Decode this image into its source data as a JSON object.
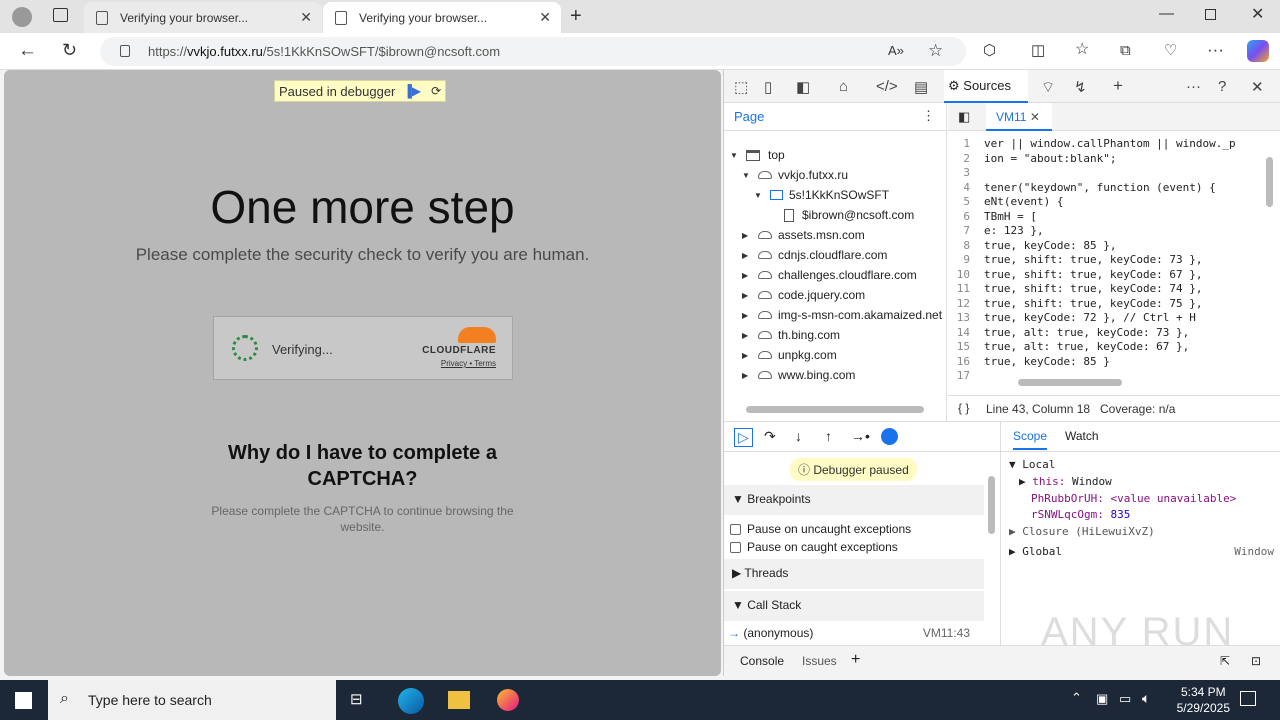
{
  "browser": {
    "tabs": [
      {
        "title": "Verifying your browser..."
      },
      {
        "title": "Verifying your browser..."
      }
    ],
    "url_prefix": "https://",
    "url_domain": "vvkjo.futxx.ru",
    "url_path": "/5s!1KkKnSOwSFT/$ibrown@ncsoft.com"
  },
  "page": {
    "paused_label": "Paused in debugger",
    "headline": "One more step",
    "subline": "Please complete the security check to verify you are human.",
    "widget_status": "Verifying...",
    "cf_brand": "CLOUDFLARE",
    "cf_links": "Privacy • Terms",
    "why_line1": "Why do I have to complete a",
    "why_line2": "CAPTCHA?",
    "why_text": "Please complete the CAPTCHA to continue browsing the website."
  },
  "devtools": {
    "active_tab": "Sources",
    "navigator_tab": "Page",
    "tree": [
      {
        "label": "top"
      },
      {
        "label": "vvkjo.futxx.ru"
      },
      {
        "label": "5s!1KkKnSOwSFT"
      },
      {
        "label": "$ibrown@ncsoft.com"
      },
      {
        "label": "assets.msn.com"
      },
      {
        "label": "cdnjs.cloudflare.com"
      },
      {
        "label": "challenges.cloudflare.com"
      },
      {
        "label": "code.jquery.com"
      },
      {
        "label": "img-s-msn-com.akamaized.net"
      },
      {
        "label": "th.bing.com"
      },
      {
        "label": "unpkg.com"
      },
      {
        "label": "www.bing.com"
      }
    ],
    "file_tab": "VM11",
    "code_lines": [
      {
        "n": "1",
        "t": "ver || window.callPhantom || window._p"
      },
      {
        "n": "2",
        "t": "ion = \"about:blank\";"
      },
      {
        "n": "3",
        "t": ""
      },
      {
        "n": "4",
        "t": "tener(\"keydown\", function (event) {"
      },
      {
        "n": "5",
        "t": "eNt(event) {"
      },
      {
        "n": "6",
        "t": "TBmH = ["
      },
      {
        "n": "7",
        "t": "e: 123 },"
      },
      {
        "n": "8",
        "t": "true, keyCode: 85 },"
      },
      {
        "n": "9",
        "t": "true, shift: true, keyCode: 73 },"
      },
      {
        "n": "10",
        "t": "true, shift: true, keyCode: 67 },"
      },
      {
        "n": "11",
        "t": "true, shift: true, keyCode: 74 },"
      },
      {
        "n": "12",
        "t": "true, shift: true, keyCode: 75 },"
      },
      {
        "n": "13",
        "t": "true, keyCode: 72 }, // Ctrl + H"
      },
      {
        "n": "14",
        "t": "true, alt: true, keyCode: 73 },"
      },
      {
        "n": "15",
        "t": "true, alt: true, keyCode: 67 },"
      },
      {
        "n": "16",
        "t": "true, keyCode: 85 }"
      },
      {
        "n": "17",
        "t": ""
      }
    ],
    "status_position": "Line 43, Column 18",
    "status_coverage": "Coverage: n/a",
    "paused_badge": "Debugger paused",
    "breakpoints_label": "Breakpoints",
    "pause_uncaught": "Pause on uncaught exceptions",
    "pause_caught": "Pause on caught exceptions",
    "threads_label": "Threads",
    "callstack_label": "Call Stack",
    "callstack_frame": "(anonymous)",
    "callstack_loc": "VM11:43",
    "scope_tab": "Scope",
    "watch_tab": "Watch",
    "scope_local": "Local",
    "scope_this_key": "this:",
    "scope_this_val": "Window",
    "scope_var1_key": "PhRubbOrUH:",
    "scope_var1_val": "<value unavailable>",
    "scope_var2_key": "rSNWLqcOgm:",
    "scope_var2_val": "835",
    "scope_closure": "Closure (HiLewuiXvZ)",
    "scope_global": "Global",
    "scope_global_val": "Window",
    "drawer_console": "Console",
    "drawer_issues": "Issues"
  },
  "taskbar": {
    "search_placeholder": "Type here to search",
    "time": "5:34 PM",
    "date": "5/29/2025"
  },
  "watermark": "ANY RUN"
}
